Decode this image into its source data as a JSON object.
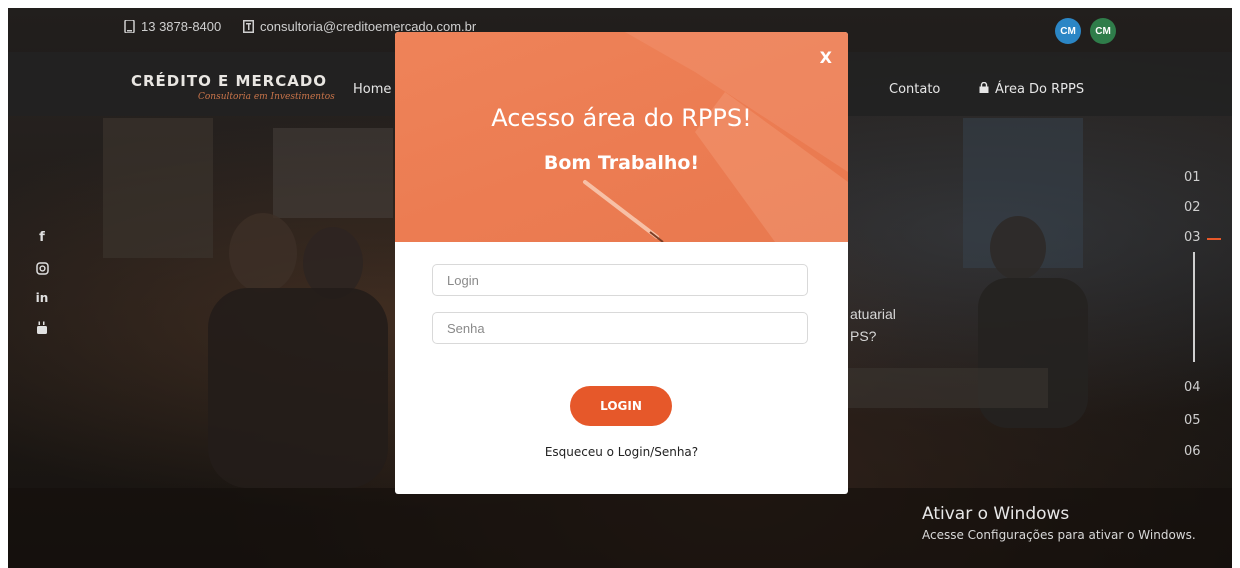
{
  "topbar": {
    "phone": "13 3878-8400",
    "email": "consultoria@creditoemercado.com.br",
    "badges": [
      {
        "label": "CM",
        "color": "#2b86c5"
      },
      {
        "label": "CM",
        "color": "#2f7d4a"
      }
    ]
  },
  "navbar": {
    "logo_main": "CRÉDITO E MERCADO",
    "logo_sub": "Consultoria em Investimentos",
    "links": [
      "Home",
      "Contato",
      "Área Do RPPS"
    ]
  },
  "social": [
    "facebook-icon",
    "instagram-icon",
    "linkedin-icon",
    "youtube-icon"
  ],
  "slides": {
    "numbers": [
      "01",
      "02",
      "03",
      "04",
      "05",
      "06"
    ],
    "active": "03"
  },
  "hero": {
    "line1_fragment": "atuarial",
    "line2_fragment": "PS?"
  },
  "modal": {
    "close_label": "X",
    "title": "Acesso área do RPPS!",
    "subtitle": "Bom Trabalho!",
    "login_placeholder": "Login",
    "password_placeholder": "Senha",
    "submit_label": "LOGIN",
    "forgot_label": "Esqueceu o Login/Senha?",
    "accent_color": "#e6582a"
  },
  "windows_watermark": {
    "title": "Ativar o Windows",
    "subtitle": "Acesse Configurações para ativar o Windows."
  }
}
